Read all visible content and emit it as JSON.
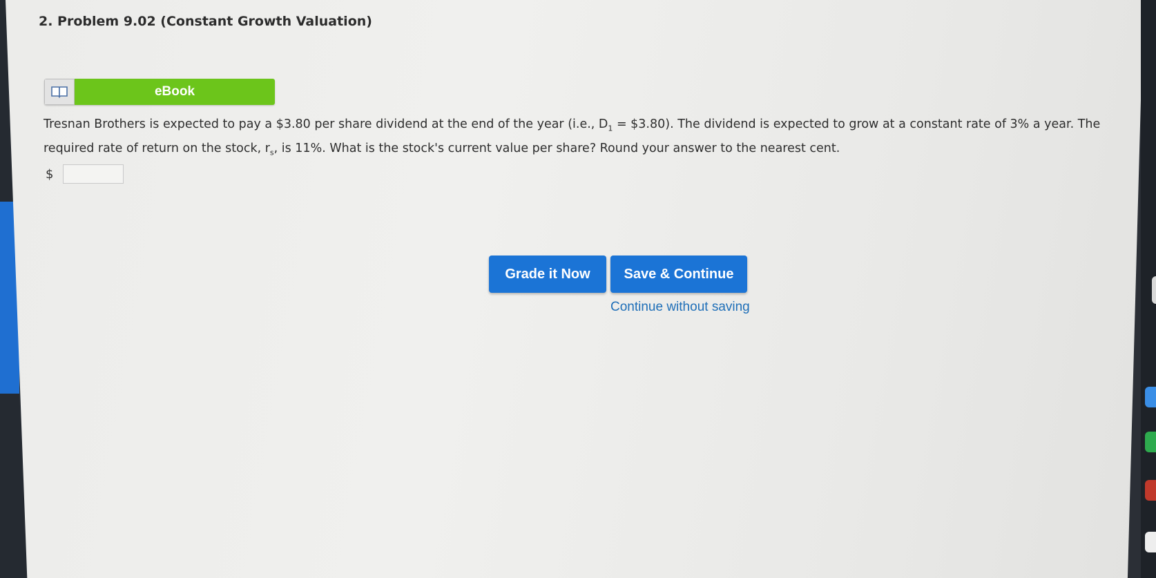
{
  "problem": {
    "title": "2. Problem 9.02 (Constant Growth Valuation)",
    "ebook_label": "eBook",
    "text_part1": "Tresnan Brothers is expected to pay a $3.80 per share dividend at the end of the year (i.e., D",
    "d_sub": "1",
    "text_part2": " = $3.80). The dividend is expected to grow at a constant rate of 3% a year. The required rate of return on the stock, r",
    "r_sub": "s",
    "text_part3": ", is 11%. What is the stock's current value per share? Round your answer to the nearest cent.",
    "currency_symbol": "$",
    "answer_value": ""
  },
  "actions": {
    "grade_label": "Grade it Now",
    "save_label": "Save & Continue",
    "continue_label": "Continue without saving"
  },
  "colors": {
    "ebook_green": "#6cc51b",
    "button_blue": "#1b74d6",
    "link_blue": "#1f6fb8"
  }
}
